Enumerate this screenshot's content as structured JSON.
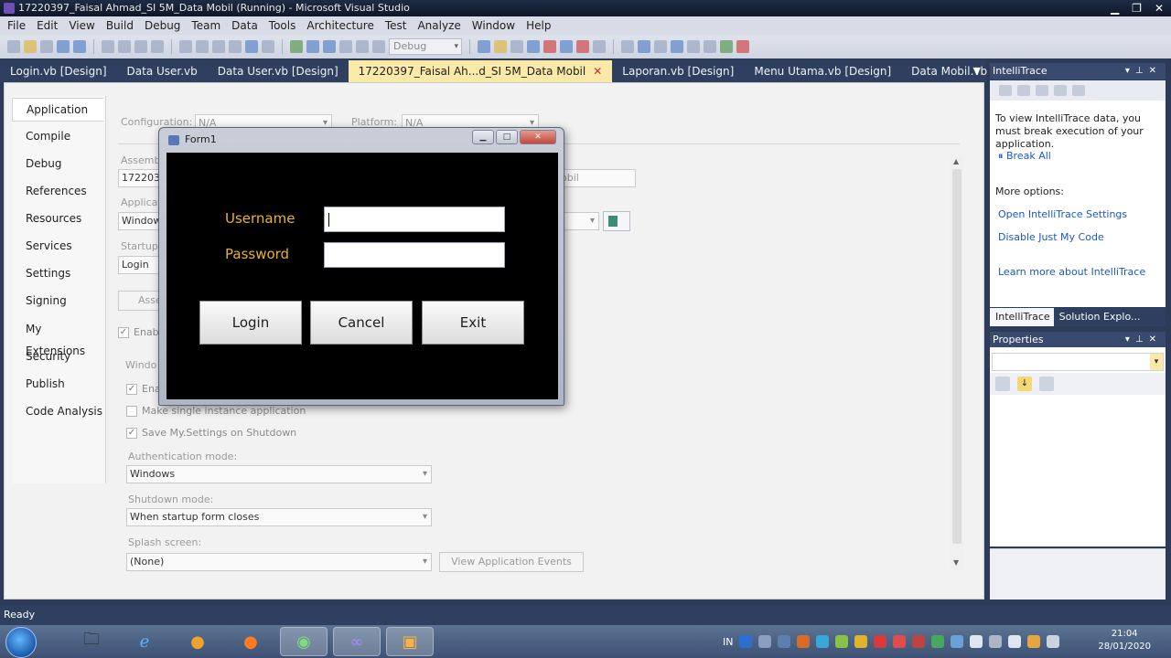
{
  "window": {
    "title": "17220397_Faisal Ahmad_SI 5M_Data Mobil (Running) - Microsoft Visual Studio"
  },
  "menu": [
    "File",
    "Edit",
    "View",
    "Build",
    "Debug",
    "Team",
    "Data",
    "Tools",
    "Architecture",
    "Test",
    "Analyze",
    "Window",
    "Help"
  ],
  "toolbar": {
    "config_combo": "Debug"
  },
  "doc_tabs": [
    {
      "label": "Login.vb [Design]"
    },
    {
      "label": "Data User.vb"
    },
    {
      "label": "Data User.vb [Design]"
    },
    {
      "label": "17220397_Faisal Ah...d_SI 5M_Data Mobil",
      "active": true
    },
    {
      "label": "Laporan.vb [Design]"
    },
    {
      "label": "Menu Utama.vb [Design]"
    },
    {
      "label": "Data Mobil.vb"
    }
  ],
  "project_nav": {
    "items": [
      "Application",
      "Compile",
      "Debug",
      "References",
      "Resources",
      "Services",
      "Settings",
      "Signing",
      "My Extensions",
      "Security",
      "Publish",
      "Code Analysis"
    ],
    "active": "Application"
  },
  "app_page": {
    "configuration_label": "Configuration:",
    "configuration_value": "N/A",
    "platform_label": "Platform:",
    "platform_value": "N/A",
    "assembly_label": "Assemb",
    "assembly_value": "1722039",
    "root_ns_tail": "obil",
    "app_type_label": "Applicat",
    "app_type_value": "Window",
    "startup_label": "Startup f",
    "startup_value": "Login",
    "assembly_btn": "Asse",
    "enable_fw": "Enab",
    "windows_section": "Windo",
    "enable_xp": "Ena",
    "single_instance": "Make single instance application",
    "save_settings": "Save My.Settings on Shutdown",
    "auth_label": "Authentication mode:",
    "auth_value": "Windows",
    "shutdown_label": "Shutdown mode:",
    "shutdown_value": "When startup form closes",
    "splash_label": "Splash screen:",
    "splash_value": "(None)",
    "view_events_btn": "View Application Events"
  },
  "form1": {
    "title": "Form1",
    "username_label": "Username",
    "password_label": "Password",
    "username_value": "",
    "password_value": "",
    "login_btn": "Login",
    "cancel_btn": "Cancel",
    "exit_btn": "Exit"
  },
  "intellitrace": {
    "title": "IntelliTrace",
    "message": "To view IntelliTrace data, you must break execution of your application.",
    "break_all": "Break All",
    "more_options": "More options:",
    "open_settings": "Open IntelliTrace Settings",
    "disable_jmc": "Disable Just My Code",
    "learn_more": "Learn more about IntelliTrace",
    "tabs": [
      "IntelliTrace",
      "Solution Explo..."
    ]
  },
  "properties": {
    "title": "Properties"
  },
  "status": {
    "text": "Ready"
  },
  "taskbar": {
    "tray_lang": "IN",
    "time": "21:04",
    "date": "28/01/2020"
  }
}
